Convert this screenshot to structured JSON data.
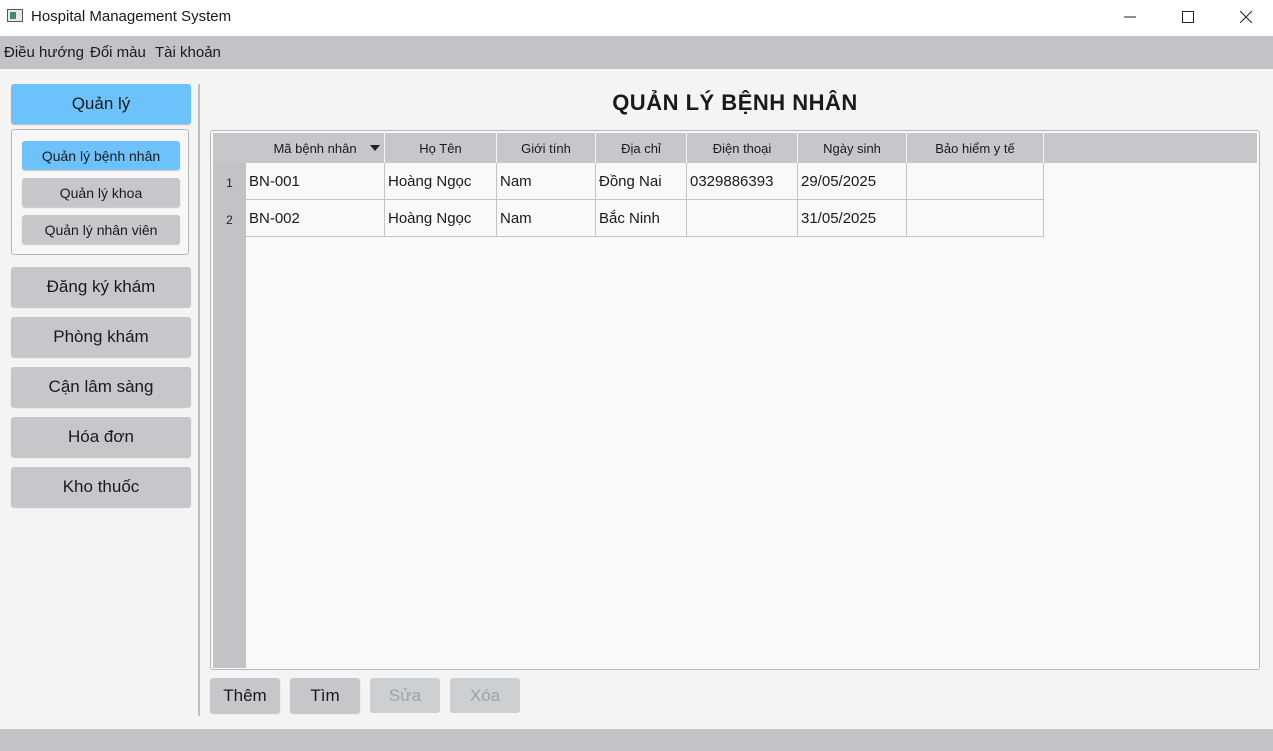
{
  "window": {
    "title": "Hospital Management System"
  },
  "menubar": {
    "items": [
      "Điều hướng",
      "Đổi màu",
      "Tài khoản"
    ]
  },
  "sidebar": {
    "manage_label": "Quản lý",
    "sub_items": [
      "Quản lý bệnh nhân",
      "Quản lý khoa",
      "Quản lý nhân viên"
    ],
    "nav_items": [
      "Đăng ký khám",
      "Phòng khám",
      "Cận lâm sàng",
      "Hóa đơn",
      "Kho thuốc"
    ]
  },
  "main": {
    "title": "QUẢN LÝ BỆNH NHÂN",
    "table": {
      "columns": [
        "Mã bệnh nhân",
        "Họ Tên",
        "Giới tính",
        "Địa chỉ",
        "Điện thoại",
        "Ngày sinh",
        "Bảo hiểm y tế"
      ],
      "rows": [
        {
          "num": "1",
          "cells": [
            "BN-001",
            "Hoàng Ngọc",
            "Nam",
            "Đồng Nai",
            "0329886393",
            "29/05/2025",
            ""
          ]
        },
        {
          "num": "2",
          "cells": [
            "BN-002",
            "Hoàng Ngọc",
            "Nam",
            "Bắc Ninh",
            "",
            "31/05/2025",
            ""
          ]
        }
      ]
    },
    "actions": {
      "add": "Thêm",
      "find": "Tìm",
      "edit": "Sửa",
      "delete": "Xóa"
    }
  },
  "colors": {
    "accent": "#6ec2fb",
    "bar": "#c1c3c7",
    "button": "#c5c7ca"
  }
}
